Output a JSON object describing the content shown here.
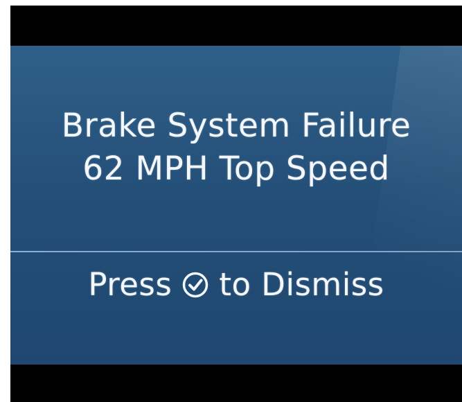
{
  "alert": {
    "line1": "Brake System Failure",
    "line2": "62 MPH Top Speed"
  },
  "prompt": {
    "before": "Press",
    "icon": "check-circle-icon",
    "after": "to Dismiss"
  },
  "colors": {
    "screen_background": "#244f78",
    "text": "#f4f7fb",
    "divider": "#96b9d7"
  }
}
